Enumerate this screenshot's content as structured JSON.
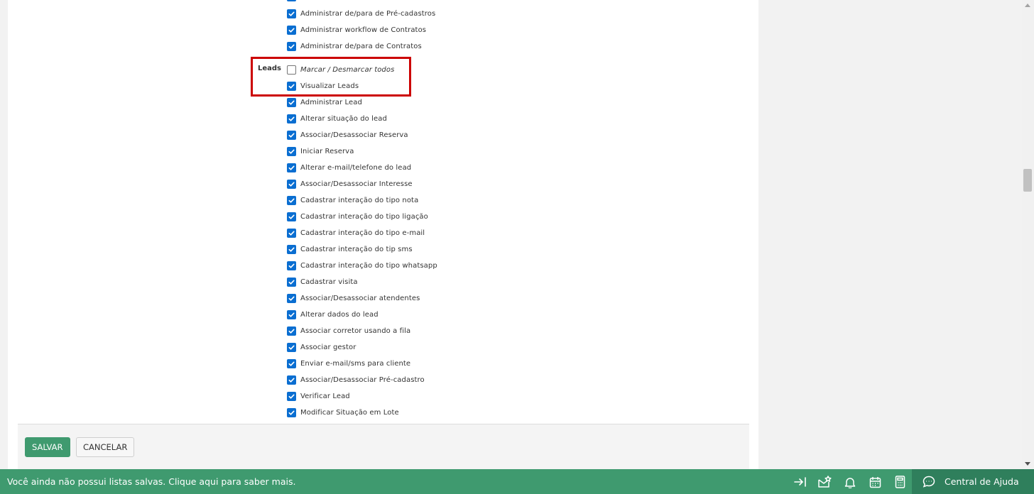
{
  "permissions_top": [
    {
      "label": "Administrar de/para de Pré-cadastros",
      "checked": true
    },
    {
      "label": "Administrar workflow de Contratos",
      "checked": true
    },
    {
      "label": "Administrar de/para de Contratos",
      "checked": true
    }
  ],
  "leads_group": {
    "label": "Leads",
    "toggle_all": {
      "label": "Marcar / Desmarcar todos",
      "checked": false
    },
    "items": [
      {
        "label": "Visualizar Leads",
        "checked": true
      },
      {
        "label": "Administrar Lead",
        "checked": true
      },
      {
        "label": "Alterar situação do lead",
        "checked": true
      },
      {
        "label": "Associar/Desassociar Reserva",
        "checked": true
      },
      {
        "label": "Iniciar Reserva",
        "checked": true
      },
      {
        "label": "Alterar e-mail/telefone do lead",
        "checked": true
      },
      {
        "label": "Associar/Desassociar Interesse",
        "checked": true
      },
      {
        "label": "Cadastrar interação do tipo nota",
        "checked": true
      },
      {
        "label": "Cadastrar interação do tipo ligação",
        "checked": true
      },
      {
        "label": "Cadastrar interação do tipo e-mail",
        "checked": true
      },
      {
        "label": "Cadastrar interação do tip sms",
        "checked": true
      },
      {
        "label": "Cadastrar interação do tipo whatsapp",
        "checked": true
      },
      {
        "label": "Cadastrar visita",
        "checked": true
      },
      {
        "label": "Associar/Desassociar atendentes",
        "checked": true
      },
      {
        "label": "Alterar dados do lead",
        "checked": true
      },
      {
        "label": "Associar corretor usando a fila",
        "checked": true
      },
      {
        "label": "Associar gestor",
        "checked": true
      },
      {
        "label": "Enviar e-mail/sms para cliente",
        "checked": true
      },
      {
        "label": "Associar/Desassociar Pré-cadastro",
        "checked": true
      },
      {
        "label": "Verificar Lead",
        "checked": true
      },
      {
        "label": "Modificar Situação em Lote",
        "checked": true
      }
    ]
  },
  "actions": {
    "save_label": "SALVAR",
    "cancel_label": "CANCELAR"
  },
  "bottom_bar": {
    "message": "Você ainda não possui listas salvas. Clique aqui para saber mais.",
    "icons": [
      "collapse-panel-icon",
      "mail-favorite-icon",
      "bell-icon",
      "calendar-icon",
      "calculator-icon"
    ],
    "help_label": "Central de Ajuda"
  },
  "colors": {
    "accent_green": "#3f9a6f",
    "help_green": "#2f7f5c",
    "checkbox_blue": "#0a6ed1",
    "highlight_red": "#cc0000"
  }
}
